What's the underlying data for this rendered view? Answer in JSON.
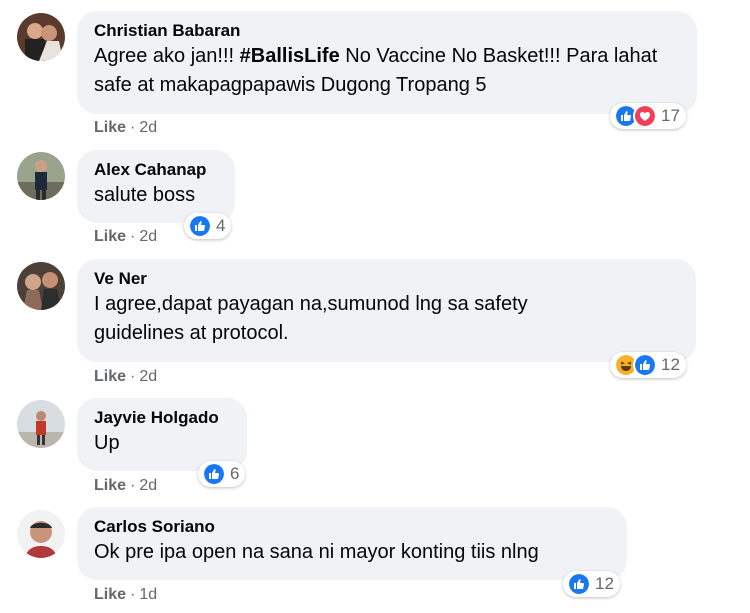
{
  "comments": [
    {
      "author": "Christian Babaran",
      "text_before": "Agree ako jan!!! ",
      "hashtag": "#BallisLife",
      "text_after": " No Vaccine No Basket!!! Para lahat safe at makapagpapawis Dugong Tropang 5",
      "like_label": "Like",
      "separator": "·",
      "time": "2d",
      "reaction_count": "17",
      "reactions": [
        "like-icon",
        "love-icon"
      ]
    },
    {
      "author": "Alex Cahanap",
      "text": "salute boss",
      "like_label": "Like",
      "separator": "·",
      "time": "2d",
      "reaction_count": "4",
      "reactions": [
        "like-icon"
      ]
    },
    {
      "author": "Ve Ner",
      "text": "I agree,dapat payagan na,sumunod lng sa safety guidelines at protocol.",
      "like_label": "Like",
      "separator": "·",
      "time": "2d",
      "reaction_count": "12",
      "reactions": [
        "haha-icon",
        "like-icon"
      ]
    },
    {
      "author": "Jayvie Holgado",
      "text": "Up",
      "like_label": "Like",
      "separator": "·",
      "time": "2d",
      "reaction_count": "6",
      "reactions": [
        "like-icon"
      ]
    },
    {
      "author": "Carlos Soriano",
      "text": "Ok pre ipa open na sana ni mayor konting tiis nlng",
      "like_label": "Like",
      "separator": "·",
      "time": "1d",
      "reaction_count": "12",
      "reactions": [
        "like-icon"
      ]
    }
  ],
  "colors": {
    "bubble": "#f0f2f5",
    "meta_text": "#65676b",
    "like_blue": "#1877f2",
    "love_red": "#f33e58",
    "haha_yellow": "#f7b125"
  }
}
